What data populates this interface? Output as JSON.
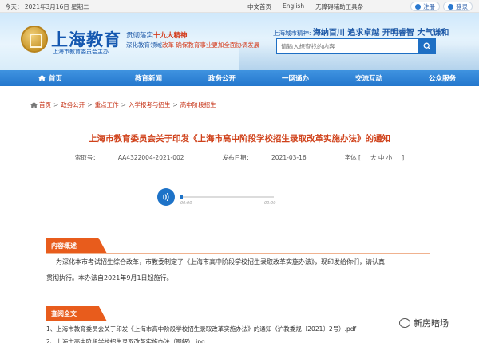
{
  "topbar": {
    "date": "今天：  2021年3月16日 星期二",
    "links": [
      "中文首页",
      "English",
      "无障碍辅助工具条"
    ],
    "register": "注册",
    "login": "登录"
  },
  "header": {
    "logo_title": "上海教育",
    "logo_sub": "上海市教育委员会主办",
    "slogan1_pre": "贯彻落实",
    "slogan1_hl": "十九大精神",
    "slogan2_pre": "深化教育领域",
    "slogan2_hl": "改革 确保教育事业更加全面协调发展",
    "spirit_pre": "上海城市精神: ",
    "spirit_main": "海纳百川 追求卓越 开明睿智 大气谦和",
    "search_placeholder": "请输入想查找的内容"
  },
  "nav": {
    "items": [
      "首页",
      "教育新闻",
      "政务公开",
      "一网通办",
      "交流互动",
      "公众服务"
    ]
  },
  "breadcrumb": [
    "首页",
    "政务公开",
    "重点工作",
    "入学报考与招生",
    "高中阶段招生"
  ],
  "article": {
    "title": "上海市教育委员会关于印发《上海市高中阶段学校招生录取改革实施办法》的通知",
    "index_label": "索取号：",
    "index_value": "AA4322004-2021-002",
    "date_label": "发布日期：",
    "date_value": "2021-03-16",
    "font_label": "字体 [",
    "font_large": "大",
    "font_mid": "中",
    "font_small": "小",
    "font_end": "]"
  },
  "audio": {
    "current": "00:00",
    "total": "00:00",
    "progress": 0
  },
  "summary": {
    "heading": "内容概述",
    "line1": "为深化本市考试招生综合改革，市教委制定了《上海市高中阶段学校招生录取改革实施办法》，现印发给你们，请认真",
    "line2": "贯彻执行。本办法自2021年9月1日起施行。"
  },
  "fulltext": {
    "heading": "查阅全文",
    "items": [
      "1、上海市教育委员会关于印发《上海市高中阶段学校招生录取改革实施办法》的通知（沪教委规〔2021〕2号）.pdf",
      "2、上海市高中阶段学校招生录取改革实施办法（图解）.jpg"
    ]
  },
  "watermark": "新房暗场",
  "colors": {
    "nav_blue": "#2477cd",
    "accent_red": "#d0421b",
    "tag_orange": "#e85c1c"
  }
}
